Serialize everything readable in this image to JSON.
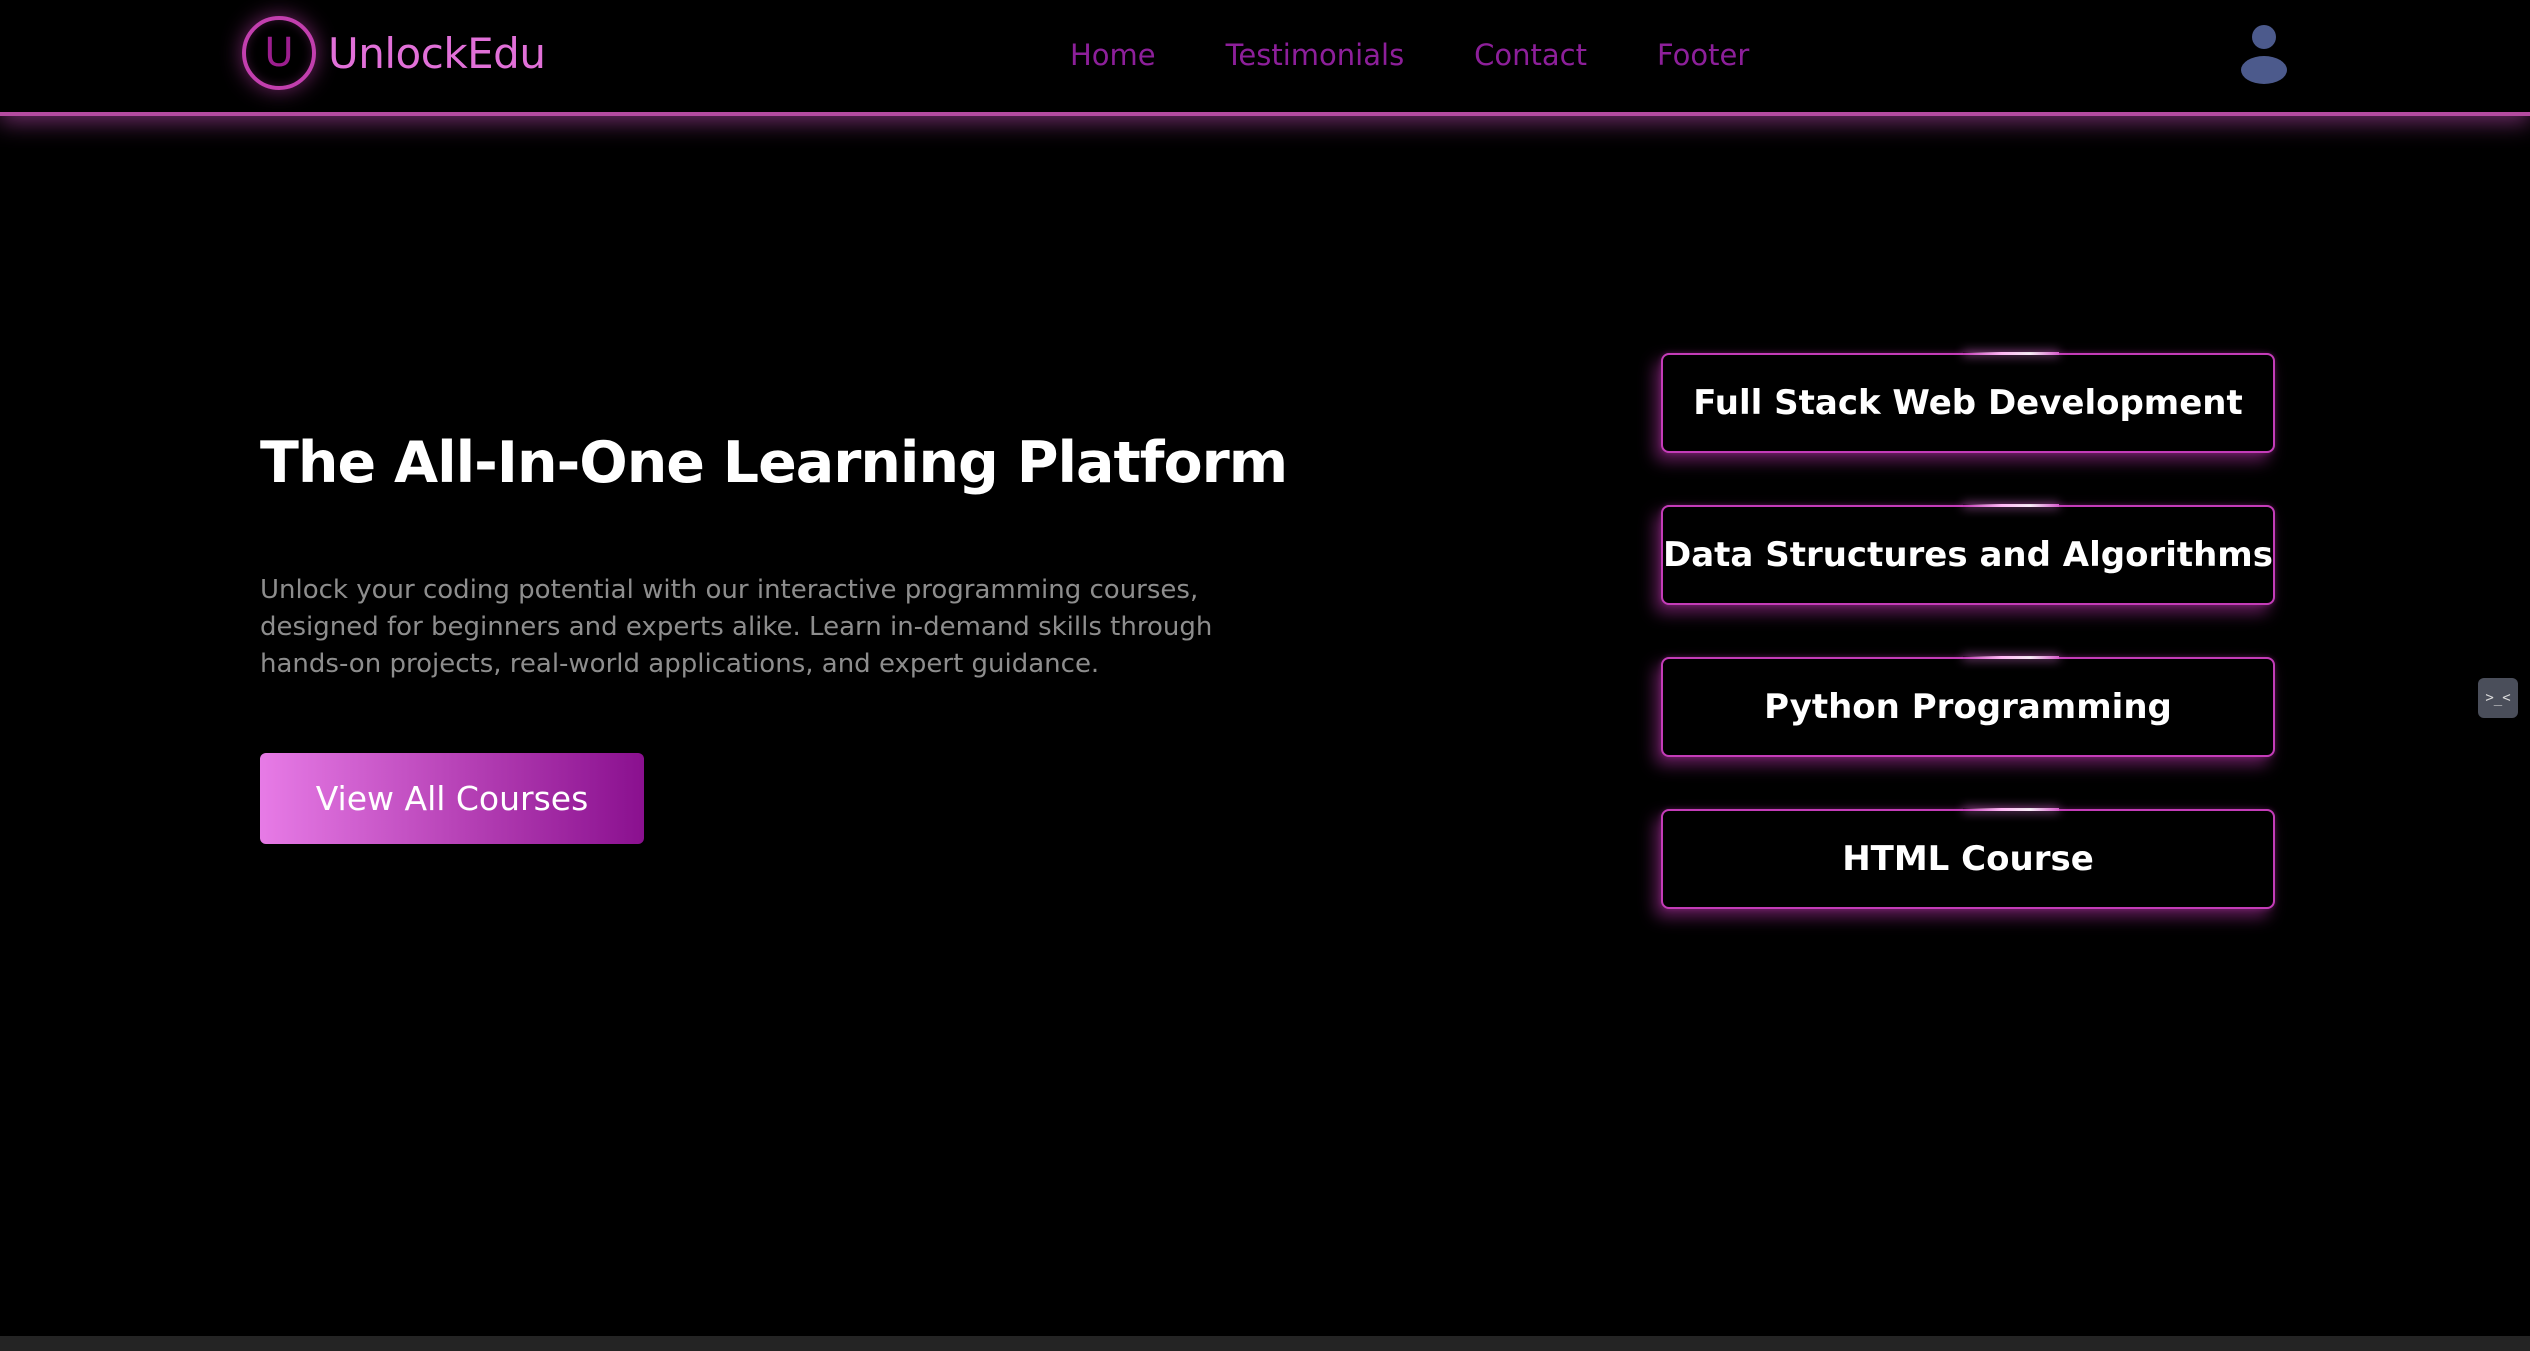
{
  "brand": {
    "logo_letter": "U",
    "name": "UnlockEdu"
  },
  "nav": {
    "items": [
      {
        "label": "Home"
      },
      {
        "label": "Testimonials"
      },
      {
        "label": "Contact"
      },
      {
        "label": "Footer"
      }
    ]
  },
  "header": {
    "avatar_icon": "user-avatar-icon"
  },
  "hero": {
    "title": "The All-In-One Learning Platform",
    "description": "Unlock your coding potential with our interactive programming courses, designed for beginners and experts alike. Learn in-demand skills through hands-on projects, real-world applications, and expert guidance.",
    "cta_label": "View All Courses"
  },
  "courses": [
    {
      "title": "Full Stack Web Development"
    },
    {
      "title": "Data Structures and Algorithms"
    },
    {
      "title": "Python Programming"
    },
    {
      "title": "HTML Course"
    }
  ],
  "side_tab": {
    "glyph": ">_<"
  },
  "colors": {
    "background": "#000000",
    "accent": "#c43cb8",
    "nav_link": "#8d1f9a",
    "brand_text": "#e170d8",
    "body_text": "#8d8d8d",
    "avatar": "#4c5a8c"
  }
}
